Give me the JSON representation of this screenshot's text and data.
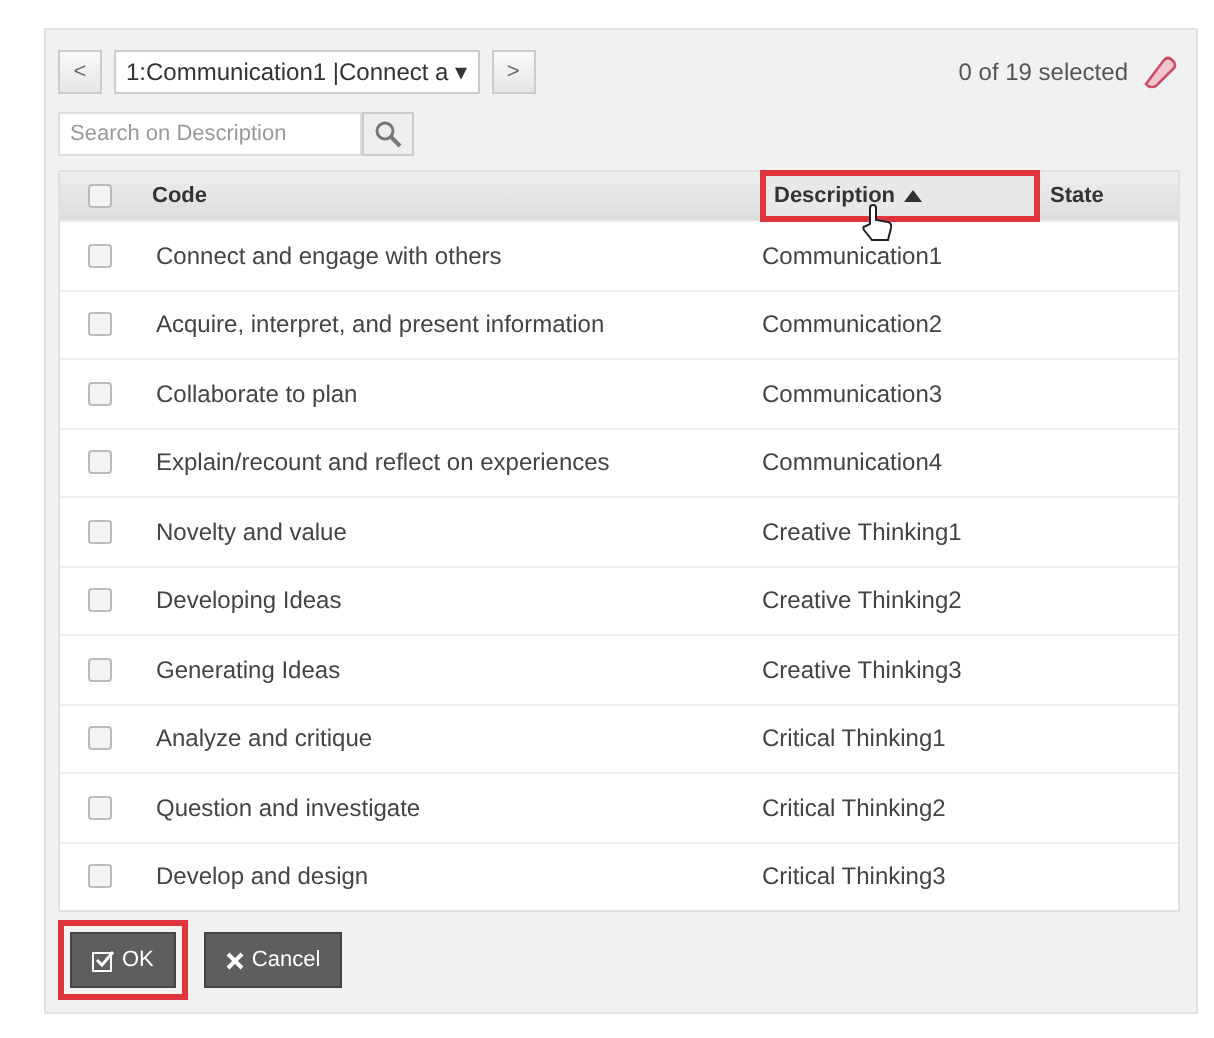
{
  "navigator": {
    "prev": "<",
    "dropdown": "1:Communication1 |Connect a ▾",
    "next": ">",
    "selection_count": "0 of 19 selected"
  },
  "search": {
    "placeholder": "Search on Description"
  },
  "table": {
    "columns": [
      {
        "label": "Code",
        "highlighted": false,
        "sorted": false
      },
      {
        "label": "Description",
        "highlighted": true,
        "sorted": true
      },
      {
        "label": "State",
        "highlighted": false,
        "sorted": false
      }
    ],
    "all_checked": false,
    "rows": [
      {
        "code": "Connect and engage with others",
        "description": "Communication1",
        "checked": false
      },
      {
        "code": "Acquire, interpret, and present information",
        "description": "Communication2",
        "checked": false
      },
      {
        "code": "Collaborate to plan",
        "description": "Communication3",
        "checked": false
      },
      {
        "code": "Explain/recount and reflect on experiences",
        "description": "Communication4",
        "checked": false
      },
      {
        "code": "Novelty and value",
        "description": "Creative Thinking1",
        "checked": false
      },
      {
        "code": "Developing Ideas",
        "description": "Creative Thinking2",
        "checked": false
      },
      {
        "code": "Generating Ideas",
        "description": "Creative Thinking3",
        "checked": false
      },
      {
        "code": "Analyze and critique",
        "description": "Critical Thinking1",
        "checked": false
      },
      {
        "code": "Question and investigate",
        "description": "Critical Thinking2",
        "checked": false
      },
      {
        "code": "Develop and design",
        "description": "Critical Thinking3",
        "checked": false
      }
    ]
  },
  "buttons": [
    {
      "kind": "ok",
      "label": "OK",
      "highlighted": true
    },
    {
      "kind": "cancel",
      "label": "Cancel",
      "highlighted": false
    }
  ]
}
